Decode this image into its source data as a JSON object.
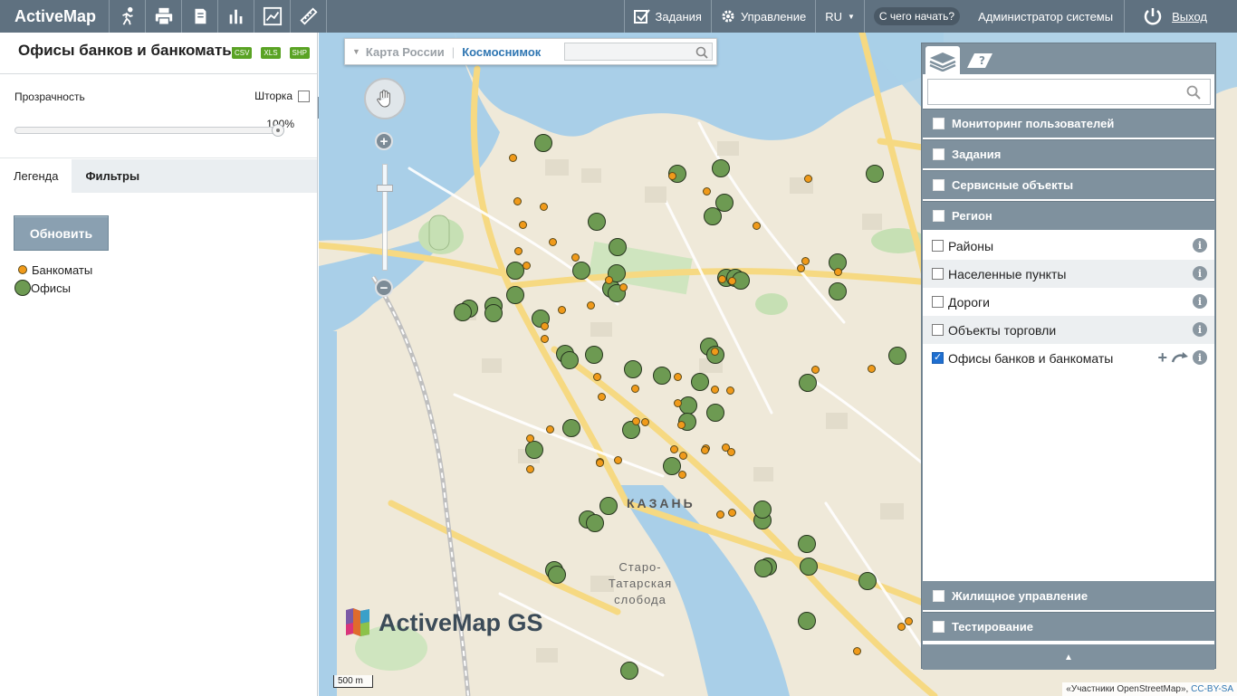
{
  "app": {
    "brand": "ActiveMap",
    "tasks": "Задания",
    "manage": "Управление",
    "lang": "RU",
    "help": "С чего начать?",
    "user": "Администратор системы",
    "logout": "Выход"
  },
  "left": {
    "title": "Офисы банков и банкоматы",
    "badges": [
      "CSV",
      "XLS",
      "SHP"
    ],
    "opacity_label": "Прозрачность",
    "curtain_label": "Шторка",
    "opacity_value": "100%",
    "opacity_fraction": 1.0,
    "tabs": [
      "Легенда",
      "Фильтры"
    ],
    "refresh": "Обновить",
    "legend": [
      "Банкоматы",
      "Офисы"
    ]
  },
  "map": {
    "basemap_inactive": "Карта России",
    "basemap_sep": "|",
    "basemap_active": "Космоснимок",
    "city": "КАЗАНЬ",
    "district_1": "Старо-",
    "district_2": "Татарская",
    "district_3": "слобода",
    "logo_text": "ActiveMap GS",
    "scale": "500 m",
    "attribution": "«Участники OpenStreetMap»,",
    "license": "CC-BY-SA",
    "colors": {
      "office": "#6d9a52",
      "atm": "#f09a1a",
      "water": "#a9cfe8",
      "land": "#efe9d9"
    }
  },
  "layers": {
    "groups": [
      "Мониторинг пользователей",
      "Задания",
      "Сервисные объекты",
      "Регион"
    ],
    "items": [
      {
        "label": "Районы",
        "checked": false
      },
      {
        "label": "Населенные пункты",
        "checked": false
      },
      {
        "label": "Дороги",
        "checked": false
      },
      {
        "label": "Объекты торговли",
        "checked": false
      },
      {
        "label": "Офисы банков и банкоматы",
        "checked": true
      }
    ],
    "bottom_groups": [
      "Жилищное управление",
      "Тестирование"
    ]
  }
}
